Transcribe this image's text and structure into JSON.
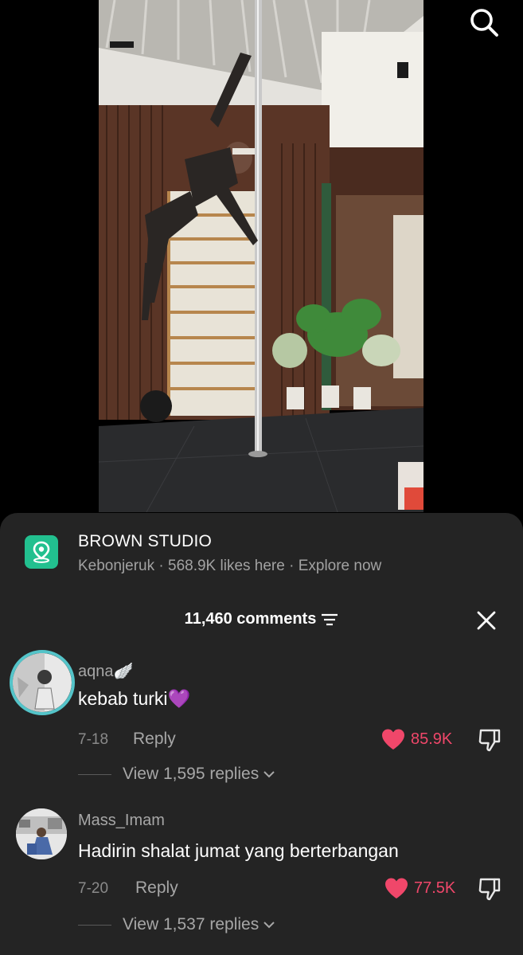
{
  "icons": {
    "search": "search-icon",
    "location": "location-pin-icon",
    "sort": "sort-icon",
    "close": "close-icon",
    "heart": "heart-icon",
    "dislike": "thumbs-down-icon",
    "chevron": "chevron-down-icon"
  },
  "colors": {
    "sheet_bg": "#242424",
    "like_red": "#f0476a",
    "location_green": "#22c08f",
    "secondary_text": "#a7a7a7"
  },
  "location": {
    "name": "BROWN STUDIO",
    "subtitle": "Kebonjeruk · 568.9K likes here · Explore now"
  },
  "comments_header": {
    "count_label": "11,460 comments"
  },
  "comments": [
    {
      "username": "aqna🪽",
      "text": "kebab turki💜",
      "date": "7-18",
      "reply_label": "Reply",
      "likes": "85.9K",
      "view_replies": "View 1,595 replies"
    },
    {
      "username": "Mass_Imam",
      "text": "Hadirin shalat jumat yang berterbangan",
      "date": "7-20",
      "reply_label": "Reply",
      "likes": "77.5K",
      "view_replies": "View 1,537 replies"
    }
  ]
}
